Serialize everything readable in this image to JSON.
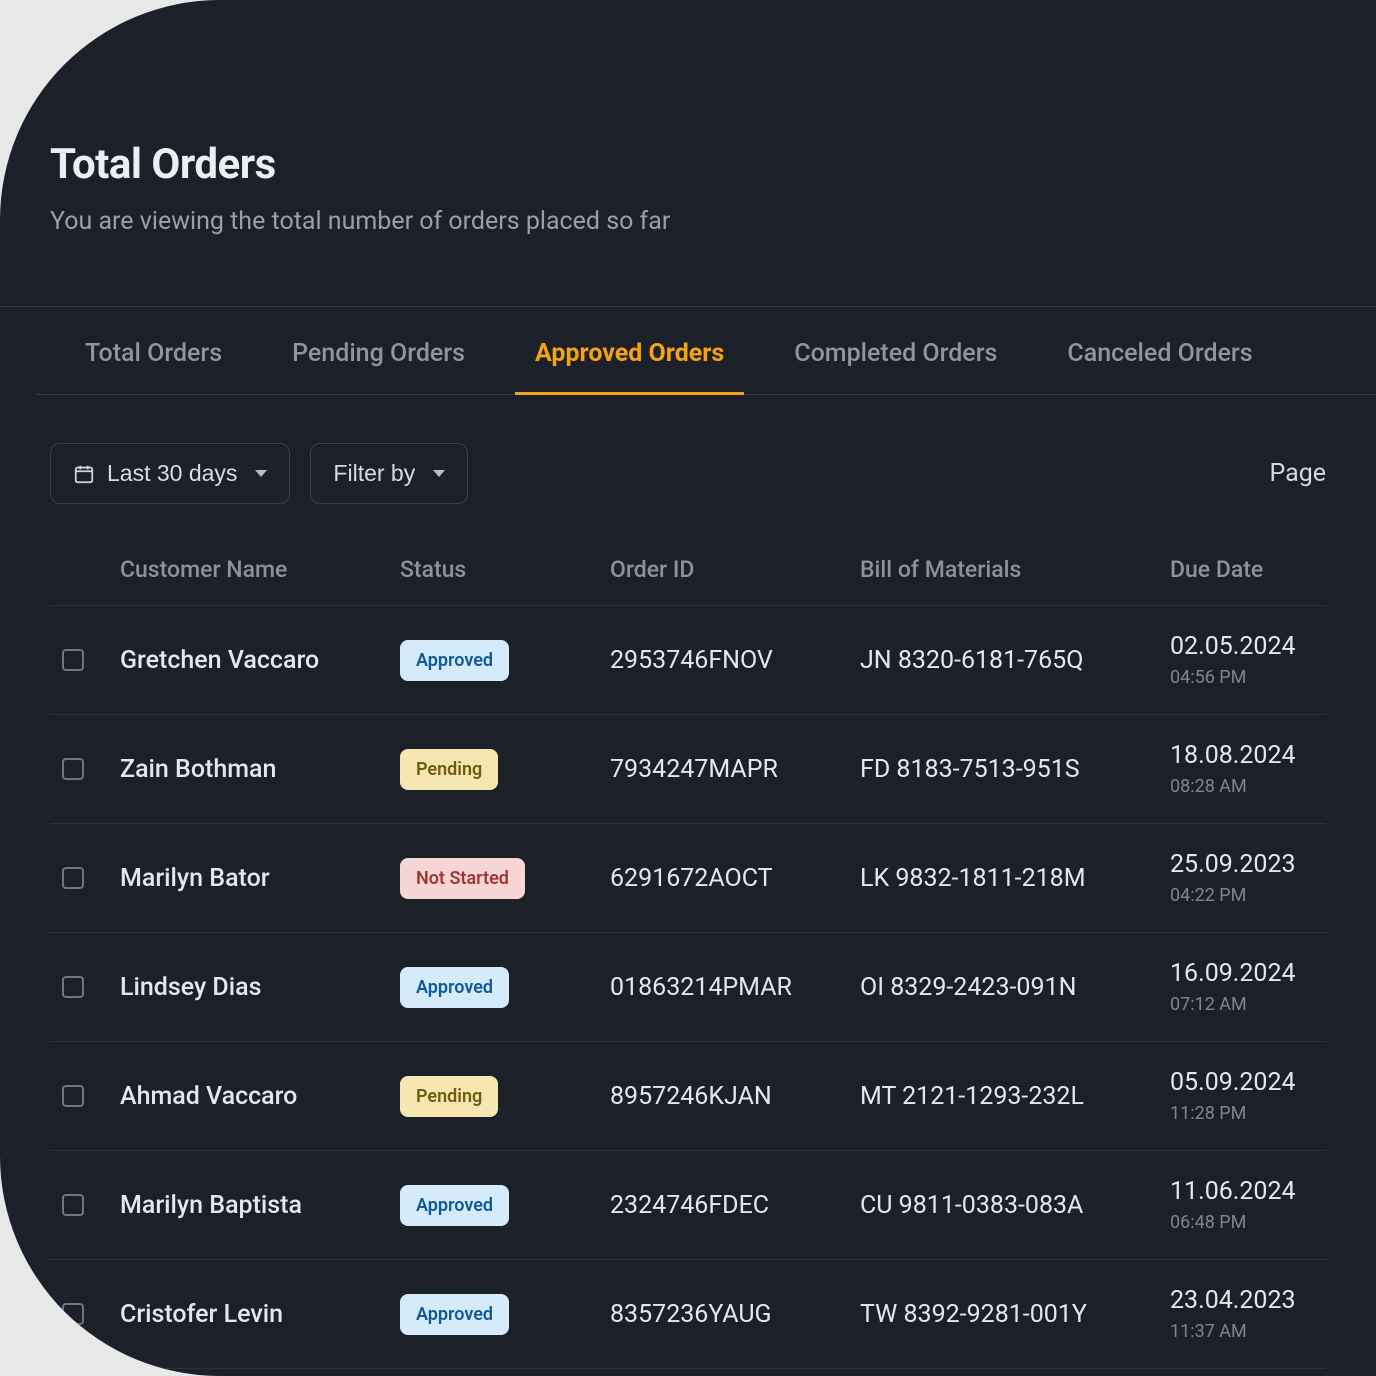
{
  "header": {
    "title": "Total Orders",
    "subtitle": "You are viewing the total number of orders placed so far"
  },
  "tabs": [
    {
      "label": "Total Orders",
      "active": false
    },
    {
      "label": "Pending Orders",
      "active": false
    },
    {
      "label": "Approved Orders",
      "active": true
    },
    {
      "label": "Completed Orders",
      "active": false
    },
    {
      "label": "Canceled Orders",
      "active": false
    }
  ],
  "filters": {
    "date_range": "Last 30 days",
    "filter_by": "Filter by",
    "page_label": "Page"
  },
  "columns": {
    "customer": "Customer Name",
    "status": "Status",
    "order_id": "Order ID",
    "bom": "Bill of Materials",
    "due": "Due Date"
  },
  "status_labels": {
    "approved": "Approved",
    "pending": "Pending",
    "notstarted": "Not Started"
  },
  "rows": [
    {
      "name": "Gretchen Vaccaro",
      "status": "approved",
      "order_id": "2953746FNOV",
      "bom": "JN 8320-6181-765Q",
      "due_date": "02.05.2024",
      "due_time": "04:56 PM"
    },
    {
      "name": "Zain Bothman",
      "status": "pending",
      "order_id": "7934247MAPR",
      "bom": "FD 8183-7513-951S",
      "due_date": "18.08.2024",
      "due_time": "08:28 AM"
    },
    {
      "name": "Marilyn Bator",
      "status": "notstarted",
      "order_id": "6291672AOCT",
      "bom": "LK 9832-1811-218M",
      "due_date": "25.09.2023",
      "due_time": "04:22 PM"
    },
    {
      "name": "Lindsey Dias",
      "status": "approved",
      "order_id": "01863214PMAR",
      "bom": "OI 8329-2423-091N",
      "due_date": "16.09.2024",
      "due_time": "07:12 AM"
    },
    {
      "name": "Ahmad Vaccaro",
      "status": "pending",
      "order_id": "8957246KJAN",
      "bom": "MT 2121-1293-232L",
      "due_date": "05.09.2024",
      "due_time": "11:28 PM"
    },
    {
      "name": "Marilyn Baptista",
      "status": "approved",
      "order_id": "2324746FDEC",
      "bom": "CU 9811-0383-083A",
      "due_date": "11.06.2024",
      "due_time": "06:48 PM"
    },
    {
      "name": "Cristofer Levin",
      "status": "approved",
      "order_id": "8357236YAUG",
      "bom": "TW 8392-9281-001Y",
      "due_date": "23.04.2023",
      "due_time": "11:37 AM"
    }
  ]
}
